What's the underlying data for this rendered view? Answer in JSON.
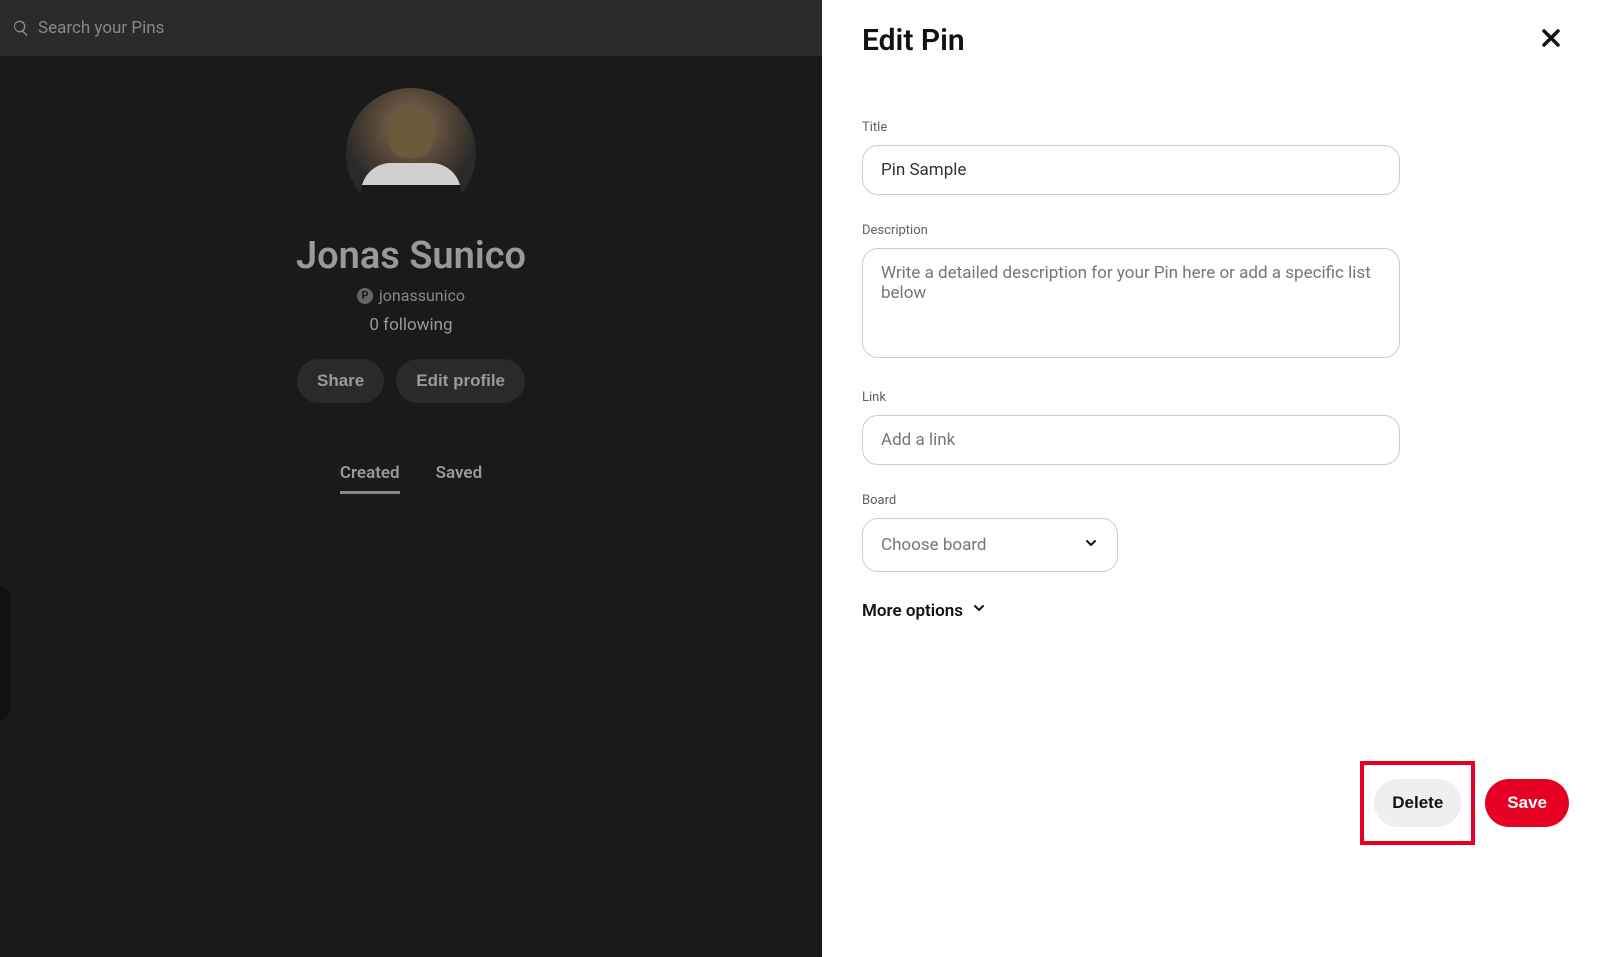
{
  "search": {
    "placeholder": "Search your Pins"
  },
  "profile": {
    "name": "Jonas Sunico",
    "username": "jonassunico",
    "following": "0 following",
    "share_label": "Share",
    "edit_profile_label": "Edit profile"
  },
  "tabs": {
    "created": "Created",
    "saved": "Saved"
  },
  "panel": {
    "title": "Edit Pin",
    "title_label": "Title",
    "title_value": "Pin Sample",
    "description_label": "Description",
    "description_placeholder": "Write a detailed description for your Pin here or add a specific list below",
    "link_label": "Link",
    "link_placeholder": "Add a link",
    "board_label": "Board",
    "board_placeholder": "Choose board",
    "more_options": "More options",
    "delete_label": "Delete",
    "save_label": "Save"
  }
}
